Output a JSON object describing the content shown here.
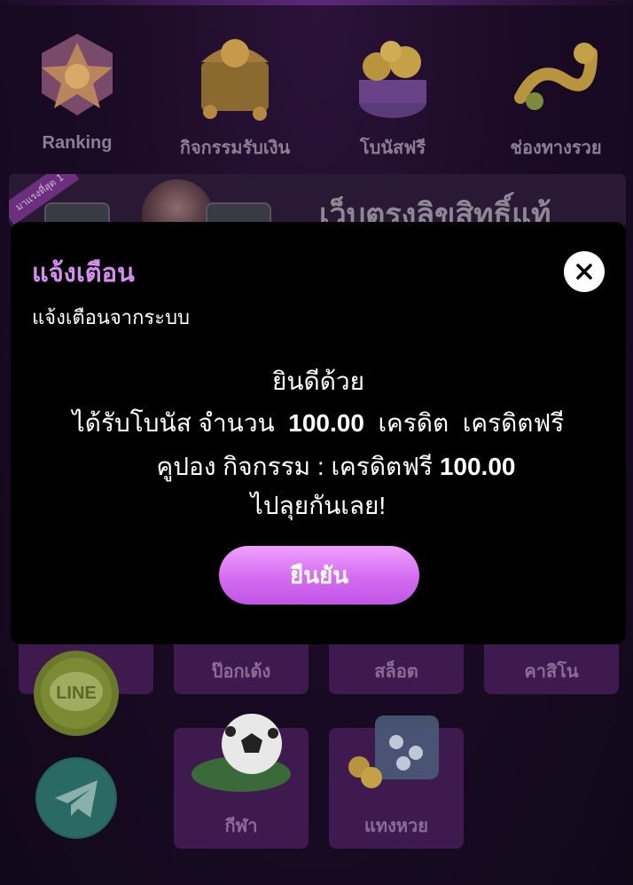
{
  "menu": {
    "items": [
      {
        "label": "Ranking",
        "icon": "ranking-badge-icon"
      },
      {
        "label": "กิจกรรมรับเงิน",
        "icon": "treasure-chest-icon"
      },
      {
        "label": "โบนัสฟรี",
        "icon": "gold-pot-icon"
      },
      {
        "label": "ช่องทางรวย",
        "icon": "gold-swirl-icon"
      }
    ]
  },
  "banner": {
    "ribbon": "มาแรงที่สุด 1",
    "text": "เว็บตรงลิขสิทธิ์แท้"
  },
  "games": {
    "items": [
      {
        "label": ""
      },
      {
        "label": "ป๊อกเด้ง"
      },
      {
        "label": "สล็อต"
      },
      {
        "label": "คาสิโน"
      },
      {
        "label": "กีฬา"
      },
      {
        "label": "แทงหวย"
      }
    ]
  },
  "side": {
    "line_label": "LINE"
  },
  "modal": {
    "title": "แจ้งเตือน",
    "subtitle": "แจ้งเตือนจากระบบ",
    "line1": "ยินดีด้วย",
    "line2_prefix": "ได้รับโบนัส จำนวน",
    "line2_amount": "100.00",
    "line2_unit": "เครดิต",
    "line2_suffix": "เครดิตฟรี",
    "line3_prefix": "คูปอง กิจกรรม :",
    "line3_type": "เครดิตฟรี",
    "line3_amount": "100.00",
    "line4": "ไปลุยกันเลย!",
    "confirm_label": "ยืนยัน"
  },
  "colors": {
    "title": "#d58df0",
    "button": "#d46cf0",
    "tile": "#3f1a4e"
  }
}
